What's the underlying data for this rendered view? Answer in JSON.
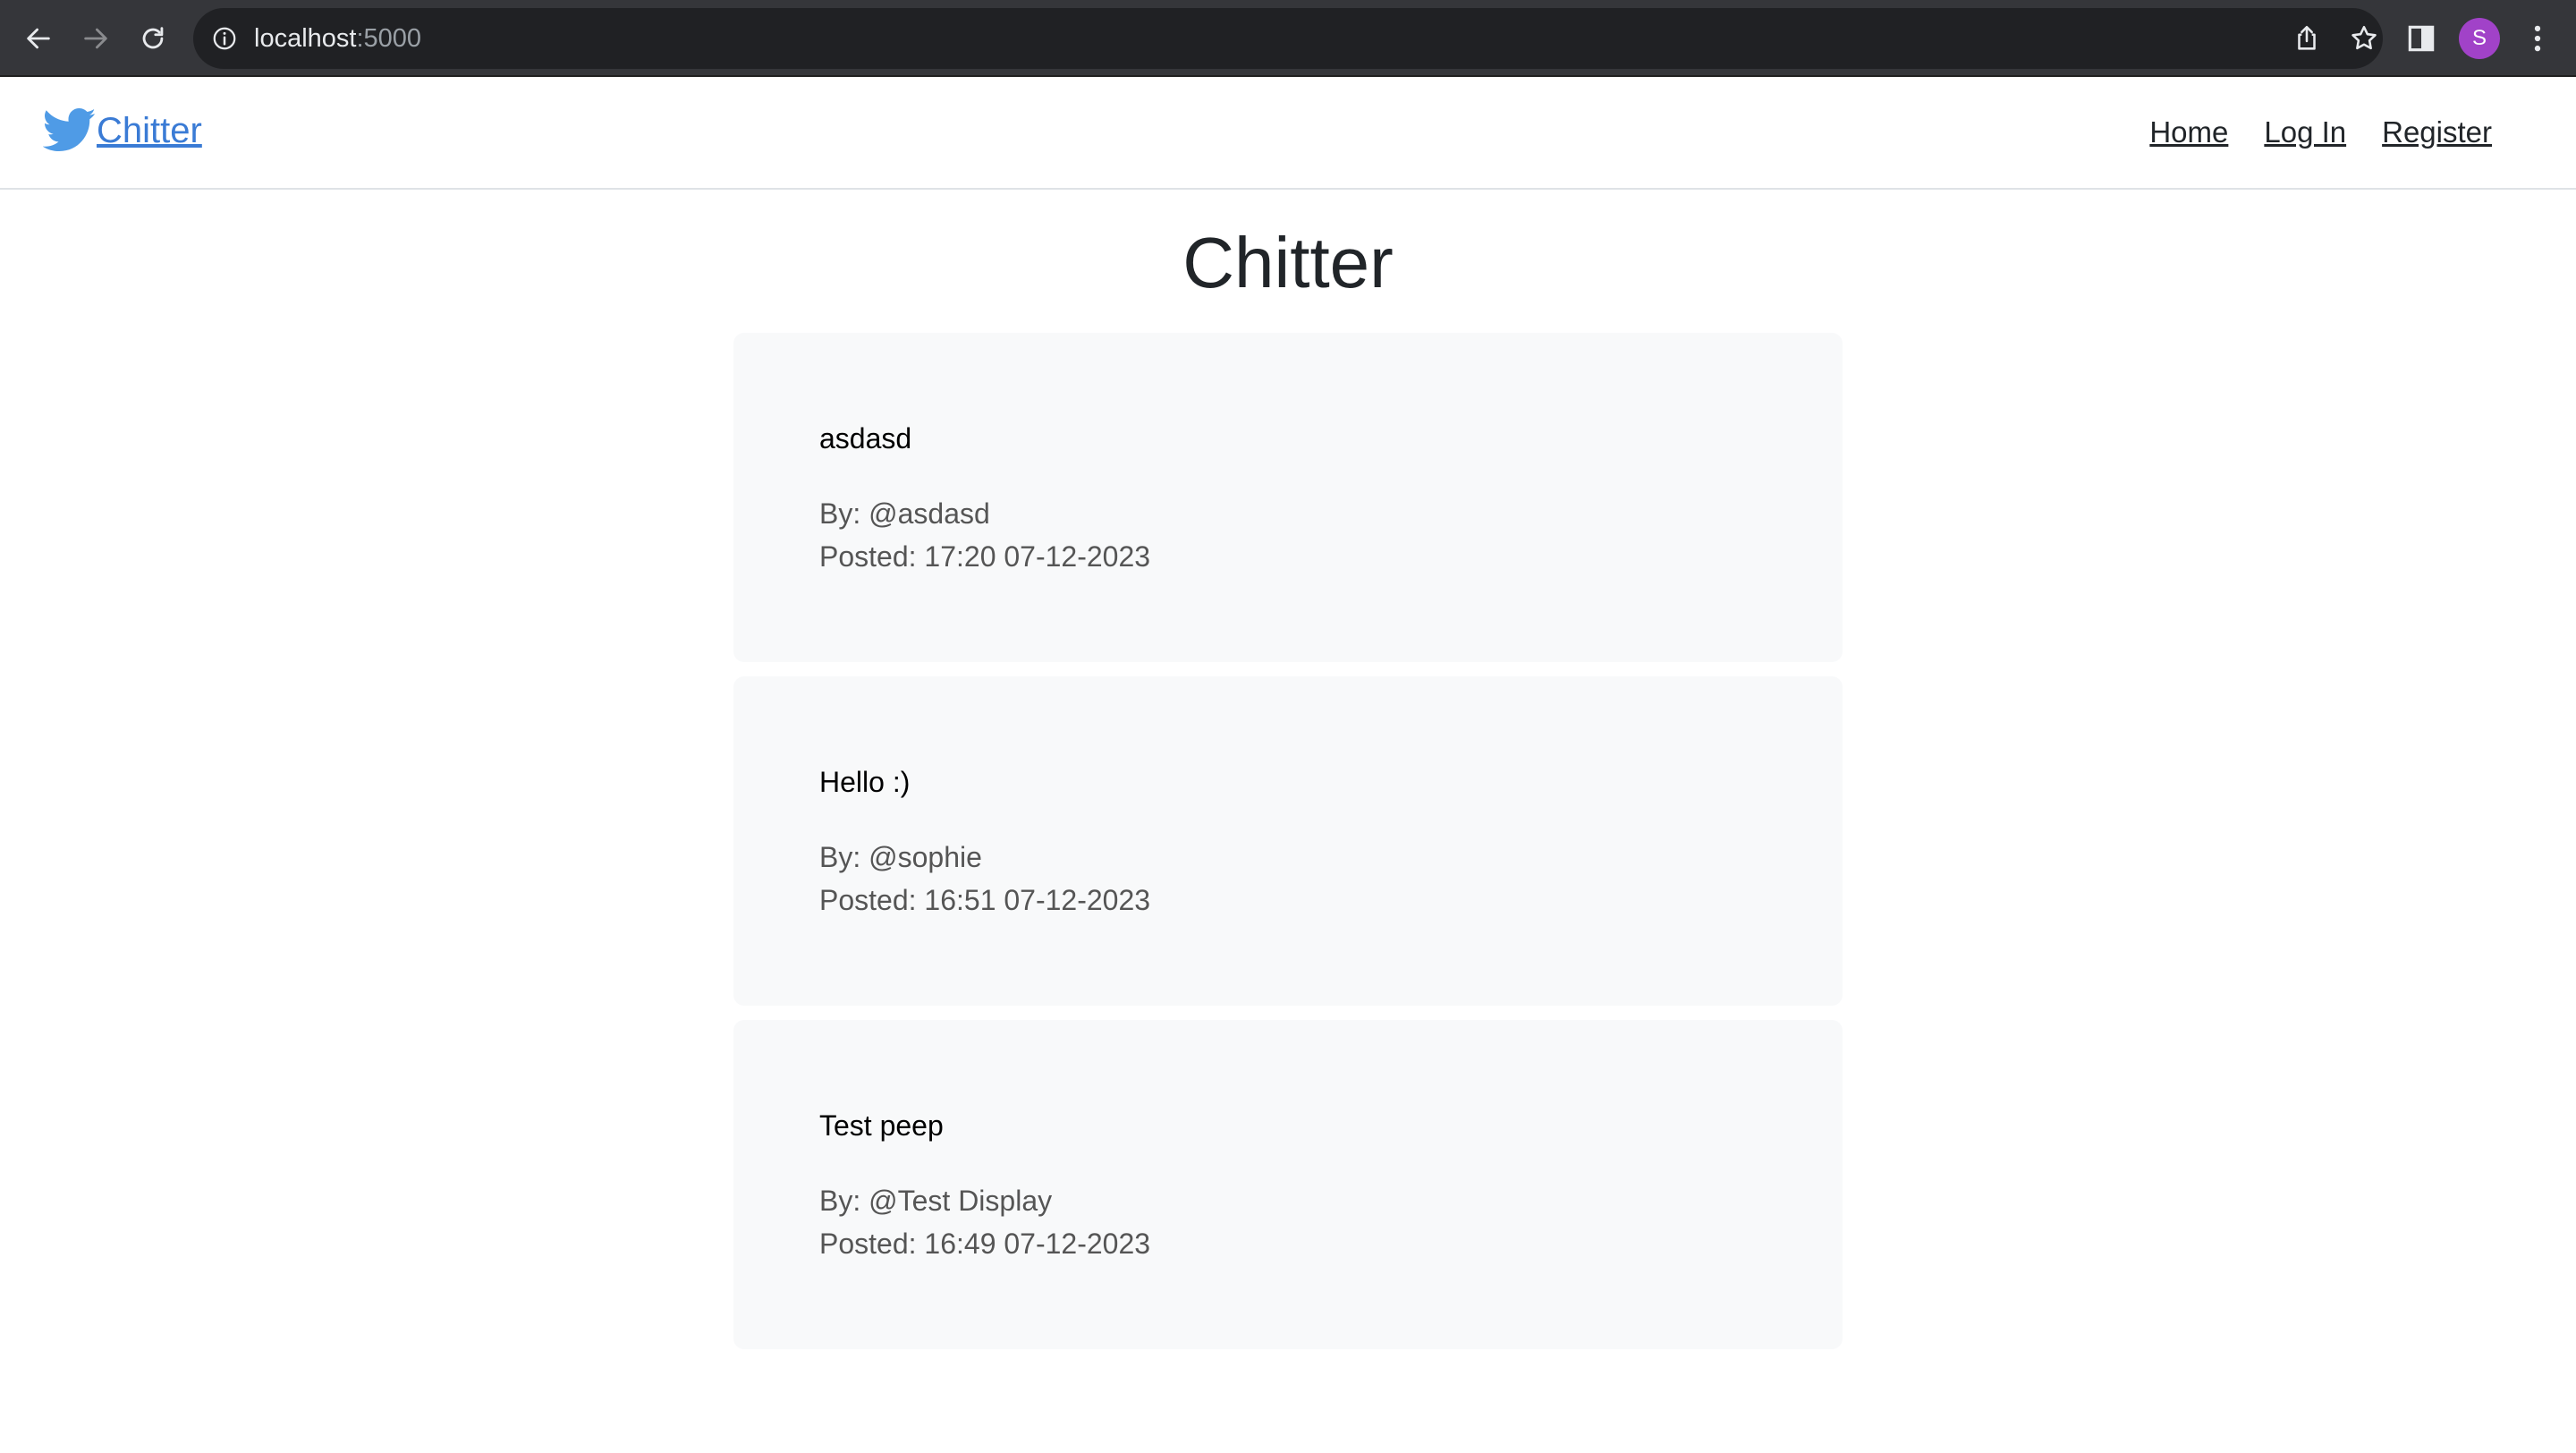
{
  "browser": {
    "url_host": "localhost",
    "url_port": ":5000",
    "profile_initial": "S"
  },
  "navbar": {
    "brand_label": "Chitter",
    "links": [
      {
        "label": "Home"
      },
      {
        "label": "Log In"
      },
      {
        "label": "Register"
      }
    ]
  },
  "main": {
    "title": "Chitter",
    "peeps": [
      {
        "text": "asdasd",
        "author": "By: @asdasd",
        "posted": "Posted: 17:20 07-12-2023"
      },
      {
        "text": "Hello :)",
        "author": "By: @sophie",
        "posted": "Posted: 16:51 07-12-2023"
      },
      {
        "text": "Test peep",
        "author": "By: @Test Display",
        "posted": "Posted: 16:49 07-12-2023"
      }
    ]
  },
  "colors": {
    "brand": "#3a7bd5",
    "card_bg": "#f8f9fa",
    "chrome_bg": "#35363a",
    "profile": "#a142c8"
  }
}
